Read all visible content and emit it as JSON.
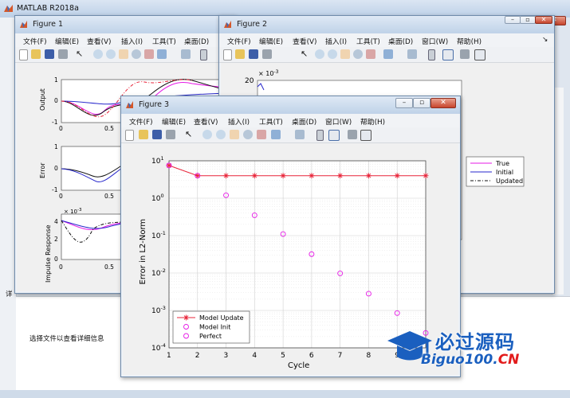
{
  "matlab": {
    "title": "MATLAB R2018a",
    "side_tab": "详",
    "status_text": "选择文件以查看详细信息"
  },
  "figure1": {
    "title": "Figure 1",
    "menu": [
      "文件(F)",
      "编辑(E)",
      "查看(V)",
      "插入(I)",
      "工具(T)",
      "桌面(D)"
    ],
    "subplots": {
      "output": {
        "ylabel": "Output",
        "yticks": [
          "1",
          "0",
          "-1"
        ],
        "xticks": [
          "0",
          "0.5"
        ]
      },
      "error": {
        "ylabel": "Error",
        "yticks": [
          "1",
          "0",
          "-1"
        ],
        "xticks": [
          "0",
          "0.5"
        ]
      },
      "impulse": {
        "ylabel": "Impulse Response",
        "exponent": "× 10",
        "exponent_power": "-3",
        "yticks": [
          "4",
          "2",
          "0"
        ],
        "xticks": [
          "0",
          "0.5"
        ]
      }
    }
  },
  "figure2": {
    "title": "Figure 2",
    "menu": [
      "文件(F)",
      "编辑(E)",
      "查看(V)",
      "插入(I)",
      "工具(T)",
      "桌面(D)",
      "窗口(W)",
      "帮助(H)"
    ],
    "axis_tick_top": "20",
    "exponent": "× 10",
    "exponent_power": "-3",
    "legend": [
      {
        "label": "True",
        "color": "#e619e6",
        "dash": "solid"
      },
      {
        "label": "Initial",
        "color": "#2727cc",
        "dash": "solid"
      },
      {
        "label": "Updated",
        "color": "#111111",
        "dash": "dashdot"
      }
    ]
  },
  "figure3": {
    "title": "Figure 3",
    "menu": [
      "文件(F)",
      "编辑(E)",
      "查看(V)",
      "插入(I)",
      "工具(T)",
      "桌面(D)",
      "窗口(W)",
      "帮助(H)"
    ],
    "chart_data": {
      "type": "scatter",
      "xlabel": "Cycle",
      "ylabel": "Error in L2-Norm",
      "xlim": [
        1,
        10
      ],
      "ylim": [
        0.0001,
        10
      ],
      "yscale": "log",
      "grid": true,
      "xticks": [
        "1",
        "2",
        "3",
        "4",
        "5",
        "6",
        "7",
        "8",
        "9"
      ],
      "ytick_powers": [
        "1",
        "0",
        "-1",
        "-2",
        "-3",
        "-4"
      ],
      "ytick_base": "10",
      "legend_position": "bottom-left",
      "series": [
        {
          "name": "Model Update",
          "color": "#e8253a",
          "marker": "star",
          "line": true,
          "x": [
            1,
            2,
            3,
            4,
            5,
            6,
            7,
            8,
            9,
            10
          ],
          "y": [
            7.5,
            4.0,
            4.0,
            4.0,
            4.0,
            4.0,
            4.0,
            4.0,
            4.0,
            4.0
          ]
        },
        {
          "name": "Model Init",
          "color": "#e619e6",
          "marker": "circle",
          "line": false,
          "x": [
            1,
            2,
            3,
            4,
            5,
            6,
            7,
            8,
            9,
            10
          ],
          "y": [
            7.5,
            4.0,
            1.2,
            0.35,
            0.11,
            0.032,
            0.0098,
            0.0028,
            0.00085,
            0.00025
          ]
        },
        {
          "name": "Perfect",
          "color": "#e619e6",
          "marker": "circle",
          "line": false,
          "x": [],
          "y": []
        }
      ]
    }
  },
  "watermark": {
    "text": "必过源码",
    "url_prefix": "Biguo100.",
    "url_suffix": "CN"
  },
  "colors": {
    "true": "#e619e6",
    "initial": "#2727cc",
    "updated": "#111111",
    "model_update": "#e8253a"
  }
}
